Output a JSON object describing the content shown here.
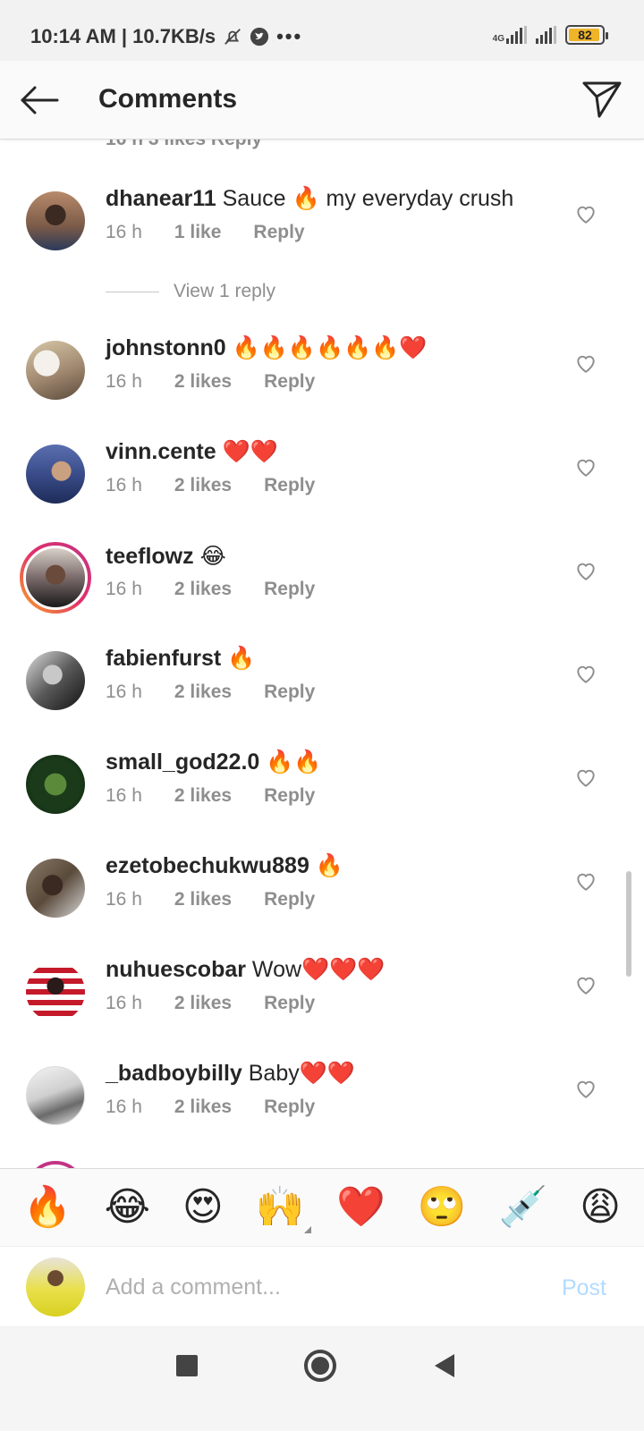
{
  "status": {
    "time_speed": "10:14 AM | 10.7KB/s",
    "network": "4G",
    "battery": "82"
  },
  "header": {
    "title": "Comments",
    "back_icon": "arrow-left-icon",
    "send_icon": "paper-plane-icon"
  },
  "partial_row": "16 h      3 likes      Reply",
  "comments": [
    {
      "username": "dhanear11",
      "text": " Sauce 🔥 my everyday crush",
      "time": "16 h",
      "likes": "1 like",
      "reply": "Reply"
    },
    {
      "username": "johnstonn0",
      "text": " 🔥🔥🔥🔥🔥🔥❤️",
      "time": "16 h",
      "likes": "2 likes",
      "reply": "Reply"
    },
    {
      "username": "vinn.cente",
      "text": " ❤️❤️",
      "time": "16 h",
      "likes": "2 likes",
      "reply": "Reply"
    },
    {
      "username": "teeflowz",
      "text": " 😂",
      "time": "16 h",
      "likes": "2 likes",
      "reply": "Reply"
    },
    {
      "username": "fabienfurst",
      "text": " 🔥",
      "time": "16 h",
      "likes": "2 likes",
      "reply": "Reply"
    },
    {
      "username": "small_god22.0",
      "text": " 🔥🔥",
      "time": "16 h",
      "likes": "2 likes",
      "reply": "Reply"
    },
    {
      "username": "ezetobechukwu889",
      "text": " 🔥",
      "time": "16 h",
      "likes": "2 likes",
      "reply": "Reply"
    },
    {
      "username": "nuhuescobar",
      "text": " Wow❤️❤️❤️",
      "time": "16 h",
      "likes": "2 likes",
      "reply": "Reply"
    },
    {
      "username": "_badboybilly",
      "text": " Baby❤️❤️",
      "time": "16 h",
      "likes": "2 likes",
      "reply": "Reply"
    }
  ],
  "view_replies": "View 1 reply",
  "emoji_bar": [
    "🔥",
    "😂",
    "😍",
    "🙌",
    "❤️",
    "🙄",
    "💉",
    "😩"
  ],
  "input": {
    "placeholder": "Add a comment...",
    "post_label": "Post"
  },
  "colors": {
    "accent_disabled": "#b3dbff",
    "secondary_text": "#8e8e8e",
    "story_ring": "#c13584"
  }
}
